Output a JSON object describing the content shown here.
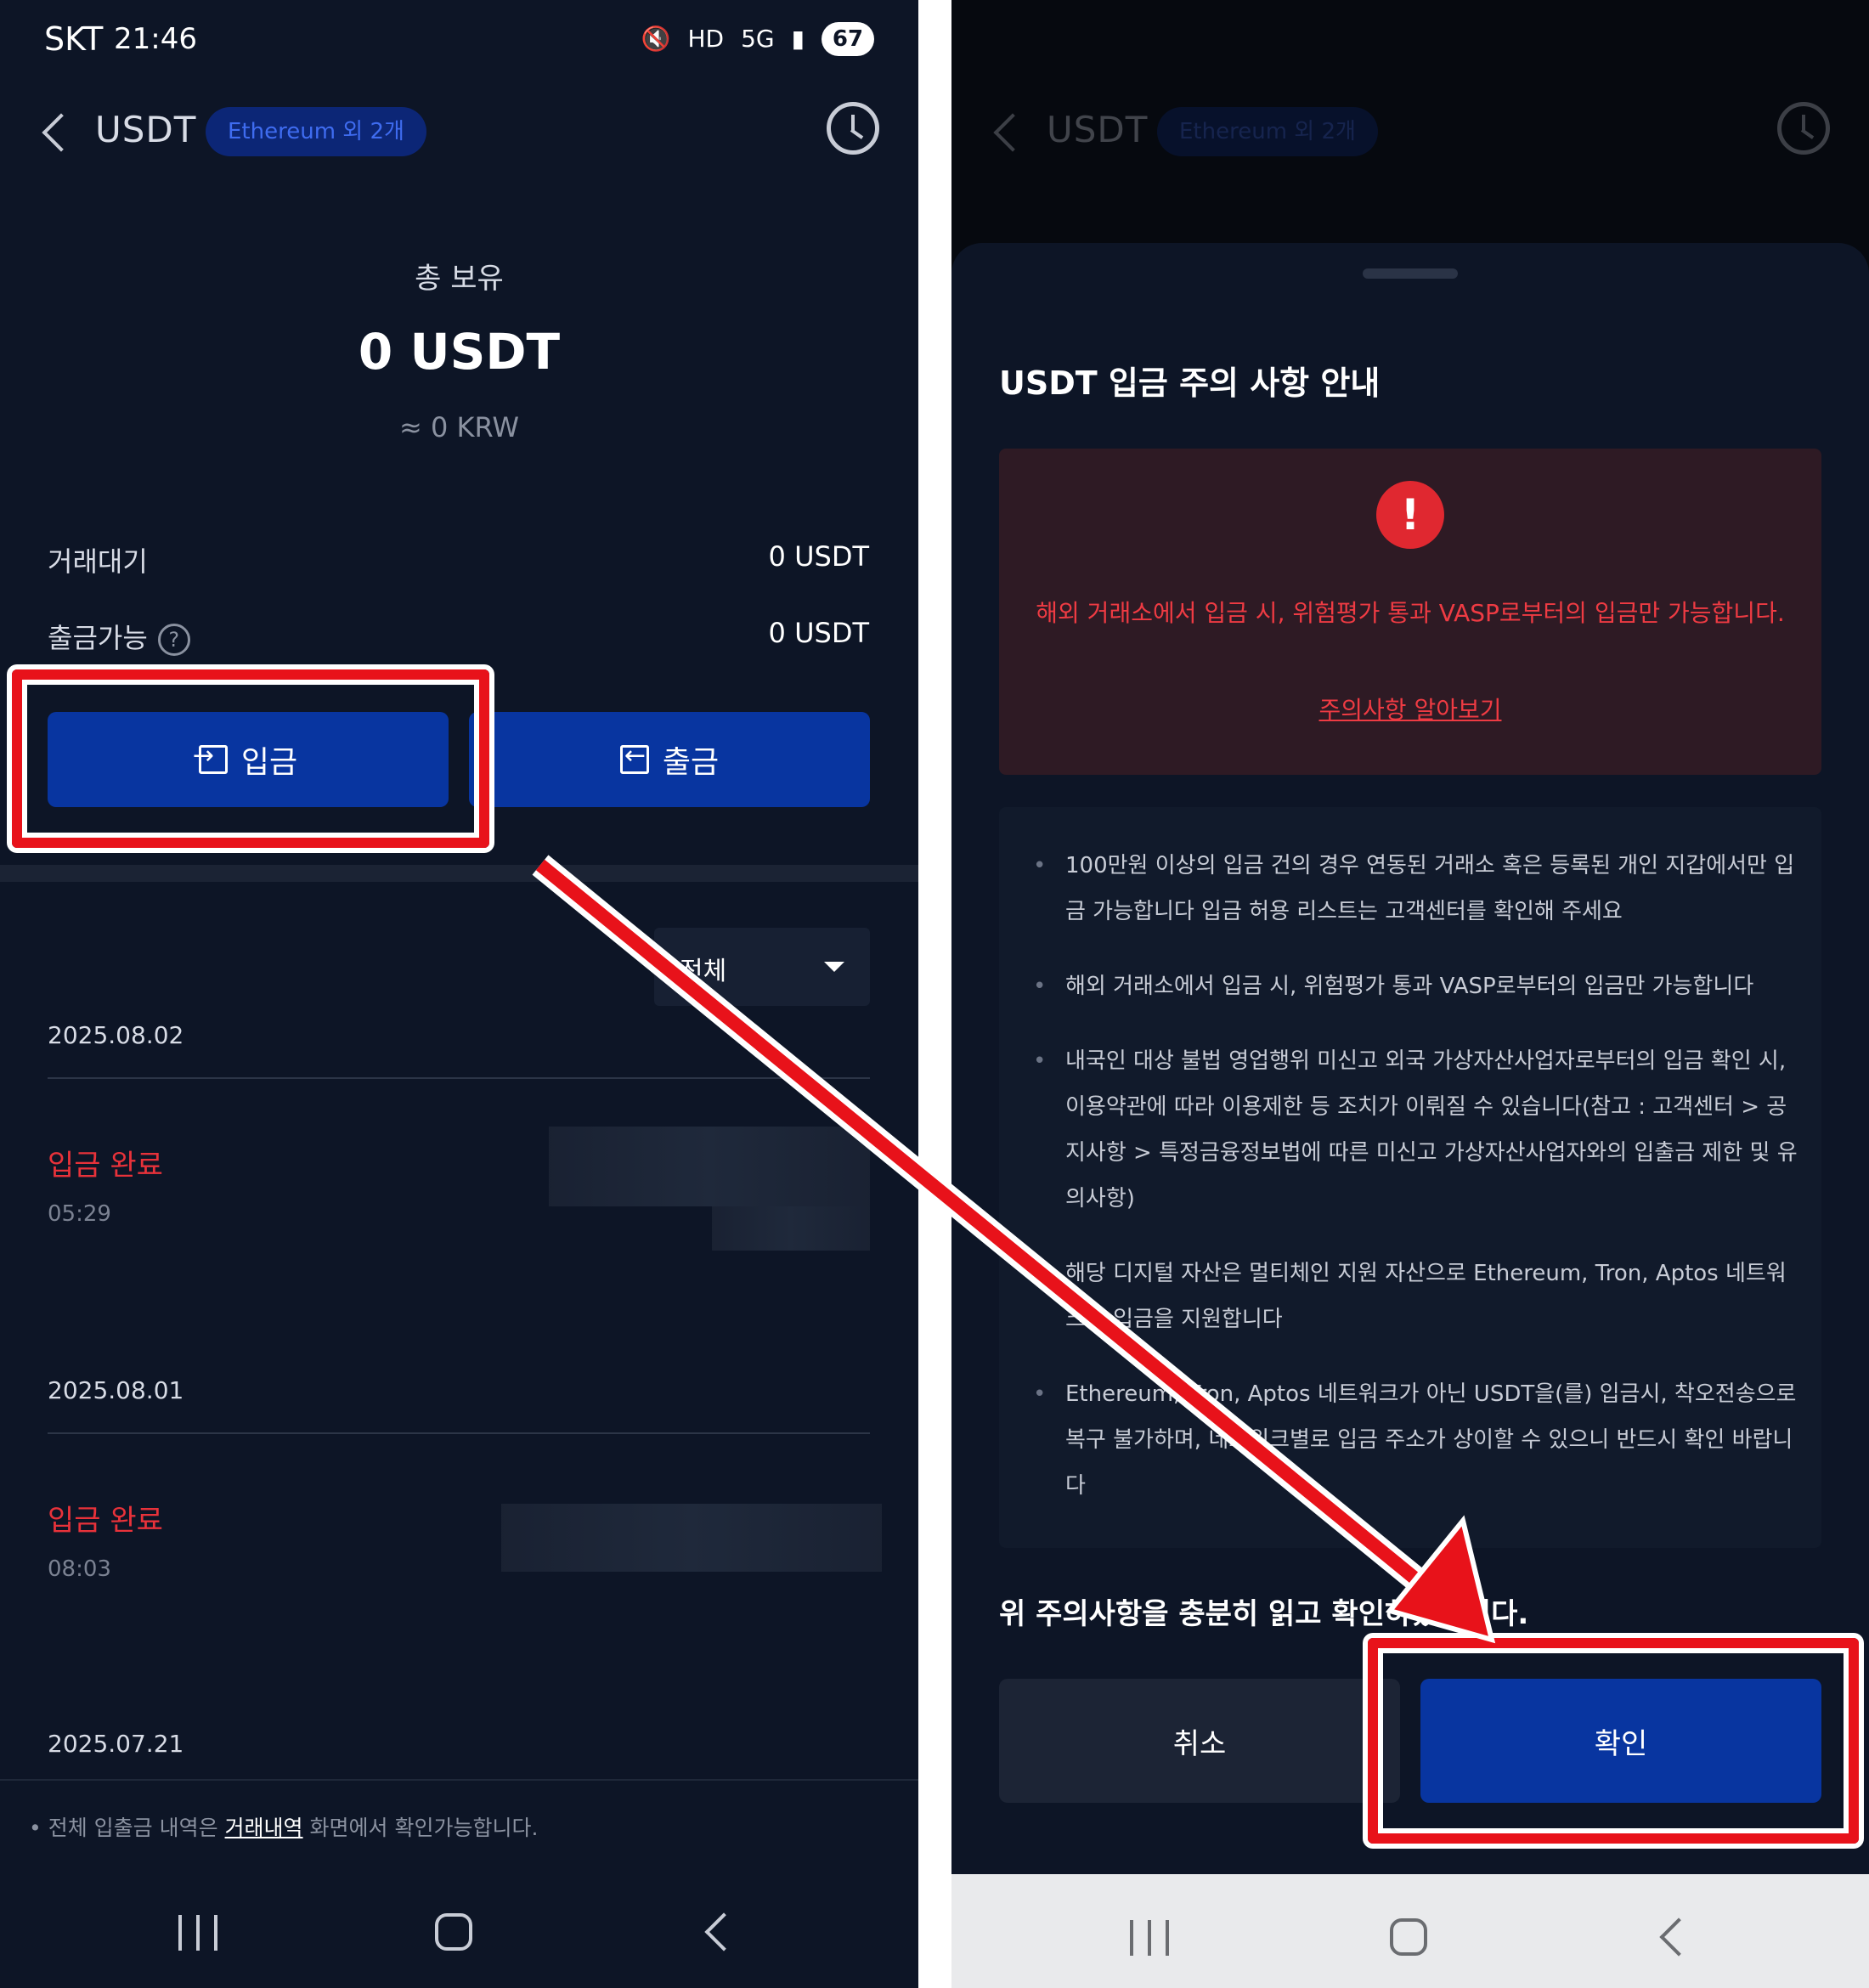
{
  "status_bar": {
    "carrier": "SKT",
    "time": "21:46",
    "battery": "67",
    "hd_voice": "HD",
    "network": "5G"
  },
  "header": {
    "title": "USDT",
    "network_badge": "Ethereum 외 2개"
  },
  "balance": {
    "label": "총 보유",
    "amount": "0 USDT",
    "krw": "≈ 0 KRW"
  },
  "rows": [
    {
      "label": "거래대기",
      "value": "0 USDT"
    },
    {
      "label": "출금가능",
      "value": "0 USDT",
      "help": "?"
    }
  ],
  "buttons": {
    "deposit": "입금",
    "withdraw": "출금"
  },
  "filter": {
    "selected": "전체"
  },
  "transactions": [
    {
      "date": "2025.08.02",
      "status": "입금 완료",
      "time": "05:29"
    },
    {
      "date": "2025.08.01",
      "status": "입금 완료",
      "time": "08:03"
    },
    {
      "date": "2025.07.21"
    }
  ],
  "footer": {
    "prefix": "전체 입출금 내역은 ",
    "link": "거래내역",
    "suffix": " 화면에서 확인가능합니다."
  },
  "dialog": {
    "title": "USDT 입금 주의 사항 안내",
    "warning_icon": "!",
    "warning_text": "해외 거래소에서 입금 시, 위험평가 통과 VASP로부터의 입금만 가능합니다.",
    "warning_link": "주의사항 알아보기",
    "notices": [
      "100만원 이상의 입금 건의 경우 연동된 거래소 혹은 등록된 개인 지갑에서만 입금 가능합니다 입금 허용 리스트는 고객센터를 확인해 주세요",
      "해외 거래소에서 입금 시, 위험평가 통과 VASP로부터의 입금만 가능합니다",
      "내국인 대상 불법 영업행위 미신고 외국 가상자산사업자로부터의 입금 확인 시, 이용약관에 따라 이용제한 등 조치가 이뤄질 수 있습니다(참고 : 고객센터 > 공지사항 > 특정금융정보법에 따른 미신고 가상자산사업자와의 입출금 제한 및 유의사항)",
      "해당 디지털 자산은 멀티체인 지원 자산으로 Ethereum, Tron, Aptos 네트워크의 입금을 지원합니다",
      "Ethereum, Tron, Aptos 네트워크가 아닌 USDT을(를) 입금시, 착오전송으로 복구 불가하며, 네트워크별로 입금 주소가 상이할 수 있으니 반드시 확인 바랍니다"
    ],
    "confirm_text": "위 주의사항을 충분히 읽고 확인하였습니다.",
    "cancel": "취소",
    "ok": "확인"
  },
  "colors": {
    "primary": "#0835a0",
    "danger": "#e8323a",
    "background": "#0d1526",
    "annotation": "#e8121a"
  }
}
